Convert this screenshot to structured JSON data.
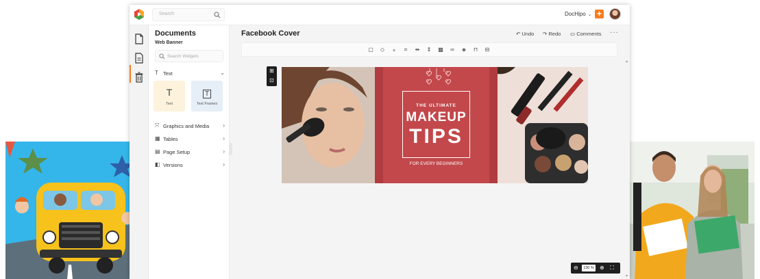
{
  "topbar": {
    "search_placeholder": "Search",
    "brand": "DocHipo",
    "add_label": "+"
  },
  "panel": {
    "title": "Documents",
    "subtitle": "Web Banner",
    "widget_search_placeholder": "Search Widgets",
    "text_section": "Text",
    "tiles": [
      {
        "label": "Text",
        "glyph": "T"
      },
      {
        "label": "Text Frames",
        "glyph": "T"
      }
    ],
    "sections": [
      {
        "label": "Graphics and Media",
        "icon": "graphics-icon"
      },
      {
        "label": "Tables",
        "icon": "table-icon"
      },
      {
        "label": "Page Setup",
        "icon": "page-setup-icon"
      },
      {
        "label": "Versions",
        "icon": "versions-icon"
      }
    ]
  },
  "main": {
    "doc_title": "Facebook Cover",
    "undo": "Undo",
    "redo": "Redo",
    "comments": "Comments",
    "more": "···",
    "zoom": "130 %"
  },
  "banner": {
    "line1": "THE ULTIMATE",
    "line2": "MAKEUP",
    "line3": "TIPS",
    "line4": "FOR EVERY BEGINNERS"
  },
  "colors": {
    "accent": "#f57c20",
    "banner_red": "#c3484b"
  }
}
